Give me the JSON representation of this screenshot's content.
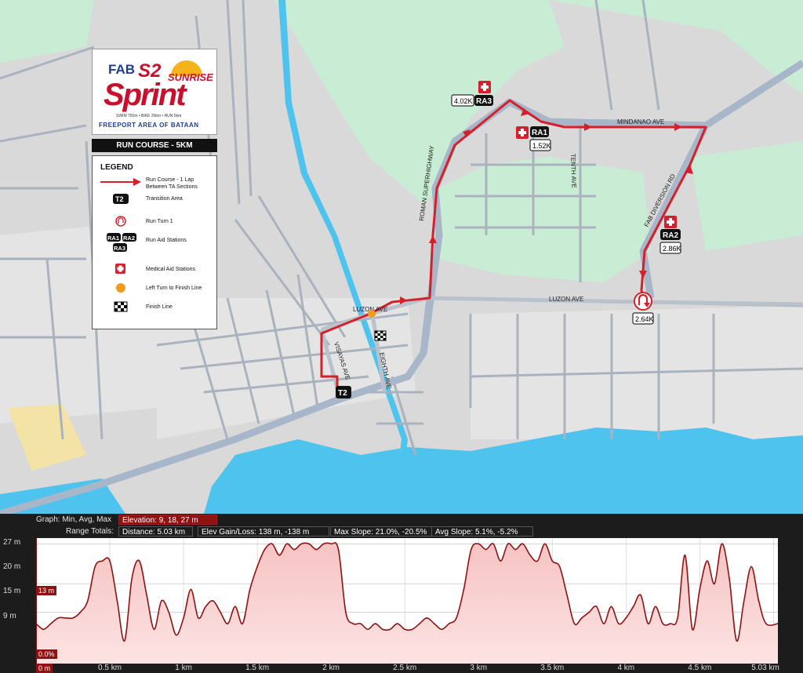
{
  "logo": {
    "brand": "FAB",
    "event_s2": "S2",
    "event_sunrise": "SUNRISE",
    "event_sprint": "Sprint",
    "distances": "SWIM 750m • BIKE 20km • RUN 5km",
    "footer": "FREEPORT AREA OF BATAAN"
  },
  "course_title": "RUN COURSE - 5KM",
  "legend": {
    "title": "LEGEND",
    "items": [
      {
        "symbol": "red-arrow",
        "text": "Run Course - 1 Lap Between TA Sections"
      },
      {
        "symbol": "T2",
        "text": "Transition Area"
      },
      {
        "symbol": "turn-icon",
        "text": "Run Turn 1"
      },
      {
        "symbol": "RA1 RA2 RA3",
        "text": "Run Aid Stations"
      },
      {
        "symbol": "medical-cross",
        "text": "Medical Aid Stations"
      },
      {
        "symbol": "orange-dot",
        "text": "Left Turn to Finish Line"
      },
      {
        "symbol": "checkered-flag",
        "text": "Finish Line"
      }
    ],
    "ra_labels": [
      "RA1",
      "RA2",
      "RA3"
    ],
    "t2_label": "T2"
  },
  "map": {
    "roads": {
      "luzon_ave_1": "LUZON AVE",
      "luzon_ave_2": "LUZON AVE",
      "visayas_ave": "VISAYAS AVE",
      "eighth_ave": "EIGHTH AVE",
      "roman_superhighway": "ROMAN SUPERHIGHWAY",
      "tenth_ave": "TENTH AVE",
      "mindanao_ave": "MINDANAO AVE",
      "fab_diversion_rd": "FAB DIVERSION RD"
    },
    "markers": {
      "ra1": {
        "label": "RA1",
        "km": "1.52K"
      },
      "ra2": {
        "label": "RA2",
        "km": "2.86K"
      },
      "ra3": {
        "label": "RA3",
        "km": "4.02K"
      },
      "turn": {
        "km": "2.64K"
      },
      "t2": "T2"
    },
    "colors": {
      "course": "#d5202b",
      "highway": "#a7b6c8",
      "water": "#4fc3ee",
      "green": "#c8eed5"
    }
  },
  "elevation": {
    "graph_label": "Graph: Min, Avg, Max",
    "elevation_text": "Elevation: 9, 18, 27 m",
    "range_label": "Range Totals:",
    "distance_text": "Distance: 5.03 km",
    "gain_text": "Elev Gain/Loss: 138 m, -138 m",
    "slope_text": "Max Slope: 21.0%, -20.5%",
    "avg_slope_text": "Avg Slope: 5.1%, -5.2%",
    "cursor_elev": "13 m",
    "cursor_grade": "0.0%",
    "cursor_dist": "0 m",
    "y_ticks": [
      "27 m",
      "20 m",
      "15 m",
      "9 m"
    ],
    "x_ticks": [
      "0.5 km",
      "1 km",
      "1.5 km",
      "2 km",
      "2.5 km",
      "3 km",
      "3.5 km",
      "4 km",
      "4.5 km",
      "5.03 km"
    ]
  },
  "chart_data": {
    "type": "area",
    "title": "",
    "xlabel": "",
    "ylabel": "",
    "xlim": [
      0,
      5.03
    ],
    "ylim": [
      6,
      28
    ],
    "x": [
      0,
      0.05,
      0.1,
      0.15,
      0.2,
      0.25,
      0.3,
      0.35,
      0.4,
      0.45,
      0.5,
      0.55,
      0.6,
      0.65,
      0.7,
      0.75,
      0.8,
      0.85,
      0.9,
      0.95,
      1.0,
      1.05,
      1.1,
      1.15,
      1.2,
      1.25,
      1.3,
      1.35,
      1.4,
      1.45,
      1.5,
      1.55,
      1.6,
      1.65,
      1.7,
      1.75,
      1.8,
      1.85,
      1.9,
      1.95,
      2.0,
      2.05,
      2.1,
      2.15,
      2.2,
      2.25,
      2.3,
      2.35,
      2.4,
      2.45,
      2.5,
      2.55,
      2.6,
      2.65,
      2.7,
      2.75,
      2.8,
      2.85,
      2.9,
      2.95,
      3.0,
      3.05,
      3.1,
      3.15,
      3.2,
      3.25,
      3.3,
      3.35,
      3.4,
      3.45,
      3.5,
      3.55,
      3.6,
      3.65,
      3.7,
      3.75,
      3.8,
      3.85,
      3.9,
      3.95,
      4.0,
      4.05,
      4.1,
      4.15,
      4.2,
      4.25,
      4.3,
      4.35,
      4.4,
      4.45,
      4.5,
      4.55,
      4.6,
      4.65,
      4.7,
      4.75,
      4.8,
      4.85,
      4.9,
      4.95,
      5.03
    ],
    "series": [
      {
        "values": [
          13,
          12,
          13,
          14,
          14,
          14,
          15,
          17,
          23,
          24,
          24,
          17,
          10,
          21,
          24,
          18,
          12,
          17,
          15,
          11,
          14,
          19,
          14,
          16,
          17,
          15,
          13,
          16,
          13,
          19,
          23,
          26,
          27,
          25,
          27,
          26,
          27,
          27,
          26,
          27,
          27,
          26,
          15,
          13,
          13,
          12,
          13,
          12,
          12,
          13,
          12,
          12,
          13,
          14,
          13,
          12,
          13,
          14,
          19,
          26,
          27,
          26,
          27,
          24,
          27,
          26,
          27,
          25,
          24,
          27,
          24,
          23,
          18,
          13,
          14,
          15,
          16,
          13,
          16,
          13,
          14,
          16,
          18,
          13,
          16,
          13,
          13,
          14,
          25,
          12,
          19,
          24,
          20,
          27,
          21,
          10,
          17,
          23,
          17,
          13,
          13
        ]
      }
    ]
  }
}
